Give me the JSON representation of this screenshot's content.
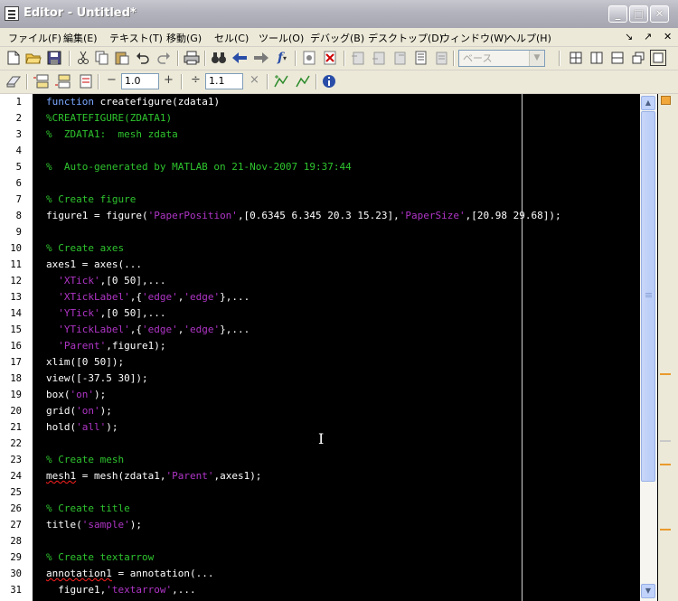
{
  "window": {
    "title": "Editor - Untitled*",
    "controls": [
      "_",
      "□",
      "✕"
    ]
  },
  "menu": {
    "items": [
      "ファイル(F)",
      "編集(E)",
      "テキスト(T)",
      "移動(G)",
      "セル(C)",
      "ツール(O)",
      "デバッグ(B)",
      "デスクトップ(D)",
      "ウィンドウ(W)",
      "ヘルプ(H)"
    ],
    "right_symbols": [
      "↘",
      "↗",
      "✕"
    ]
  },
  "toolbar": {
    "style_select_value": "ベース",
    "cell_minus": "−",
    "cell_value_1": "1.0",
    "cell_plus": "+",
    "divide_symbol": "÷",
    "cell_value_2": "1.1",
    "times_symbol": "×"
  },
  "editor": {
    "line_numbers": [
      "1",
      "2",
      "3",
      "4",
      "5",
      "6",
      "7",
      "8",
      "9",
      "10",
      "11",
      "12",
      "13",
      "14",
      "15",
      "16",
      "17",
      "18",
      "19",
      "20",
      "21",
      "22",
      "23",
      "24",
      "25",
      "26",
      "27",
      "28",
      "29",
      "30",
      "31"
    ],
    "lines": [
      [
        [
          "kw",
          "function "
        ],
        [
          "tx",
          "createfigure(zdata1)"
        ]
      ],
      [
        [
          "cm",
          "%CREATEFIGURE(ZDATA1)"
        ]
      ],
      [
        [
          "cm",
          "%  ZDATA1:  mesh zdata"
        ]
      ],
      [],
      [
        [
          "cm",
          "%  Auto-generated by MATLAB on 21-Nov-2007 19:37:44"
        ]
      ],
      [],
      [
        [
          "cm",
          "% Create figure"
        ]
      ],
      [
        [
          "tx",
          "figure1 = figure("
        ],
        [
          "st",
          "'PaperPosition'"
        ],
        [
          "tx",
          ",[0.6345 6.345 20.3 15.23],"
        ],
        [
          "st",
          "'PaperSize'"
        ],
        [
          "tx",
          ",[20.98 29.68]);"
        ]
      ],
      [],
      [
        [
          "cm",
          "% Create axes"
        ]
      ],
      [
        [
          "tx",
          "axes1 = axes(..."
        ]
      ],
      [
        [
          "tx",
          "  "
        ],
        [
          "st",
          "'XTick'"
        ],
        [
          "tx",
          ",[0 50],..."
        ]
      ],
      [
        [
          "tx",
          "  "
        ],
        [
          "st",
          "'XTickLabel'"
        ],
        [
          "tx",
          ",{"
        ],
        [
          "st",
          "'edge'"
        ],
        [
          "tx",
          ","
        ],
        [
          "st",
          "'edge'"
        ],
        [
          "tx",
          "},..."
        ]
      ],
      [
        [
          "tx",
          "  "
        ],
        [
          "st",
          "'YTick'"
        ],
        [
          "tx",
          ",[0 50],..."
        ]
      ],
      [
        [
          "tx",
          "  "
        ],
        [
          "st",
          "'YTickLabel'"
        ],
        [
          "tx",
          ",{"
        ],
        [
          "st",
          "'edge'"
        ],
        [
          "tx",
          ","
        ],
        [
          "st",
          "'edge'"
        ],
        [
          "tx",
          "},..."
        ]
      ],
      [
        [
          "tx",
          "  "
        ],
        [
          "st",
          "'Parent'"
        ],
        [
          "tx",
          ",figure1);"
        ]
      ],
      [
        [
          "tx",
          "xlim([0 50]);"
        ]
      ],
      [
        [
          "tx",
          "view([-37.5 30]);"
        ]
      ],
      [
        [
          "tx",
          "box("
        ],
        [
          "st",
          "'on'"
        ],
        [
          "tx",
          ");"
        ]
      ],
      [
        [
          "tx",
          "grid("
        ],
        [
          "st",
          "'on'"
        ],
        [
          "tx",
          ");"
        ]
      ],
      [
        [
          "tx",
          "hold("
        ],
        [
          "st",
          "'all'"
        ],
        [
          "tx",
          ");"
        ]
      ],
      [],
      [
        [
          "cm",
          "% Create mesh"
        ]
      ],
      [
        [
          "sq",
          "mesh1"
        ],
        [
          "tx",
          " = mesh(zdata1,"
        ],
        [
          "st",
          "'Parent'"
        ],
        [
          "tx",
          ",axes1);"
        ]
      ],
      [],
      [
        [
          "cm",
          "% Create title"
        ]
      ],
      [
        [
          "tx",
          "title("
        ],
        [
          "st",
          "'sample'"
        ],
        [
          "tx",
          ");"
        ]
      ],
      [],
      [
        [
          "cm",
          "% Create textarrow"
        ]
      ],
      [
        [
          "sq",
          "annotation1"
        ],
        [
          "tx",
          " = annotation(..."
        ]
      ],
      [
        [
          "tx",
          "  figure1,"
        ],
        [
          "st",
          "'textarrow'"
        ],
        [
          "tx",
          ",..."
        ]
      ]
    ]
  },
  "scrollbar": {
    "up_arrow": "▲",
    "down_arrow": "▼"
  },
  "colors": {
    "keyword": "#7aa7ff",
    "comment": "#2ec42e",
    "string": "#b035c7",
    "text": "#ffffff",
    "background": "#000000",
    "warning_marker": "#e99a2c"
  }
}
